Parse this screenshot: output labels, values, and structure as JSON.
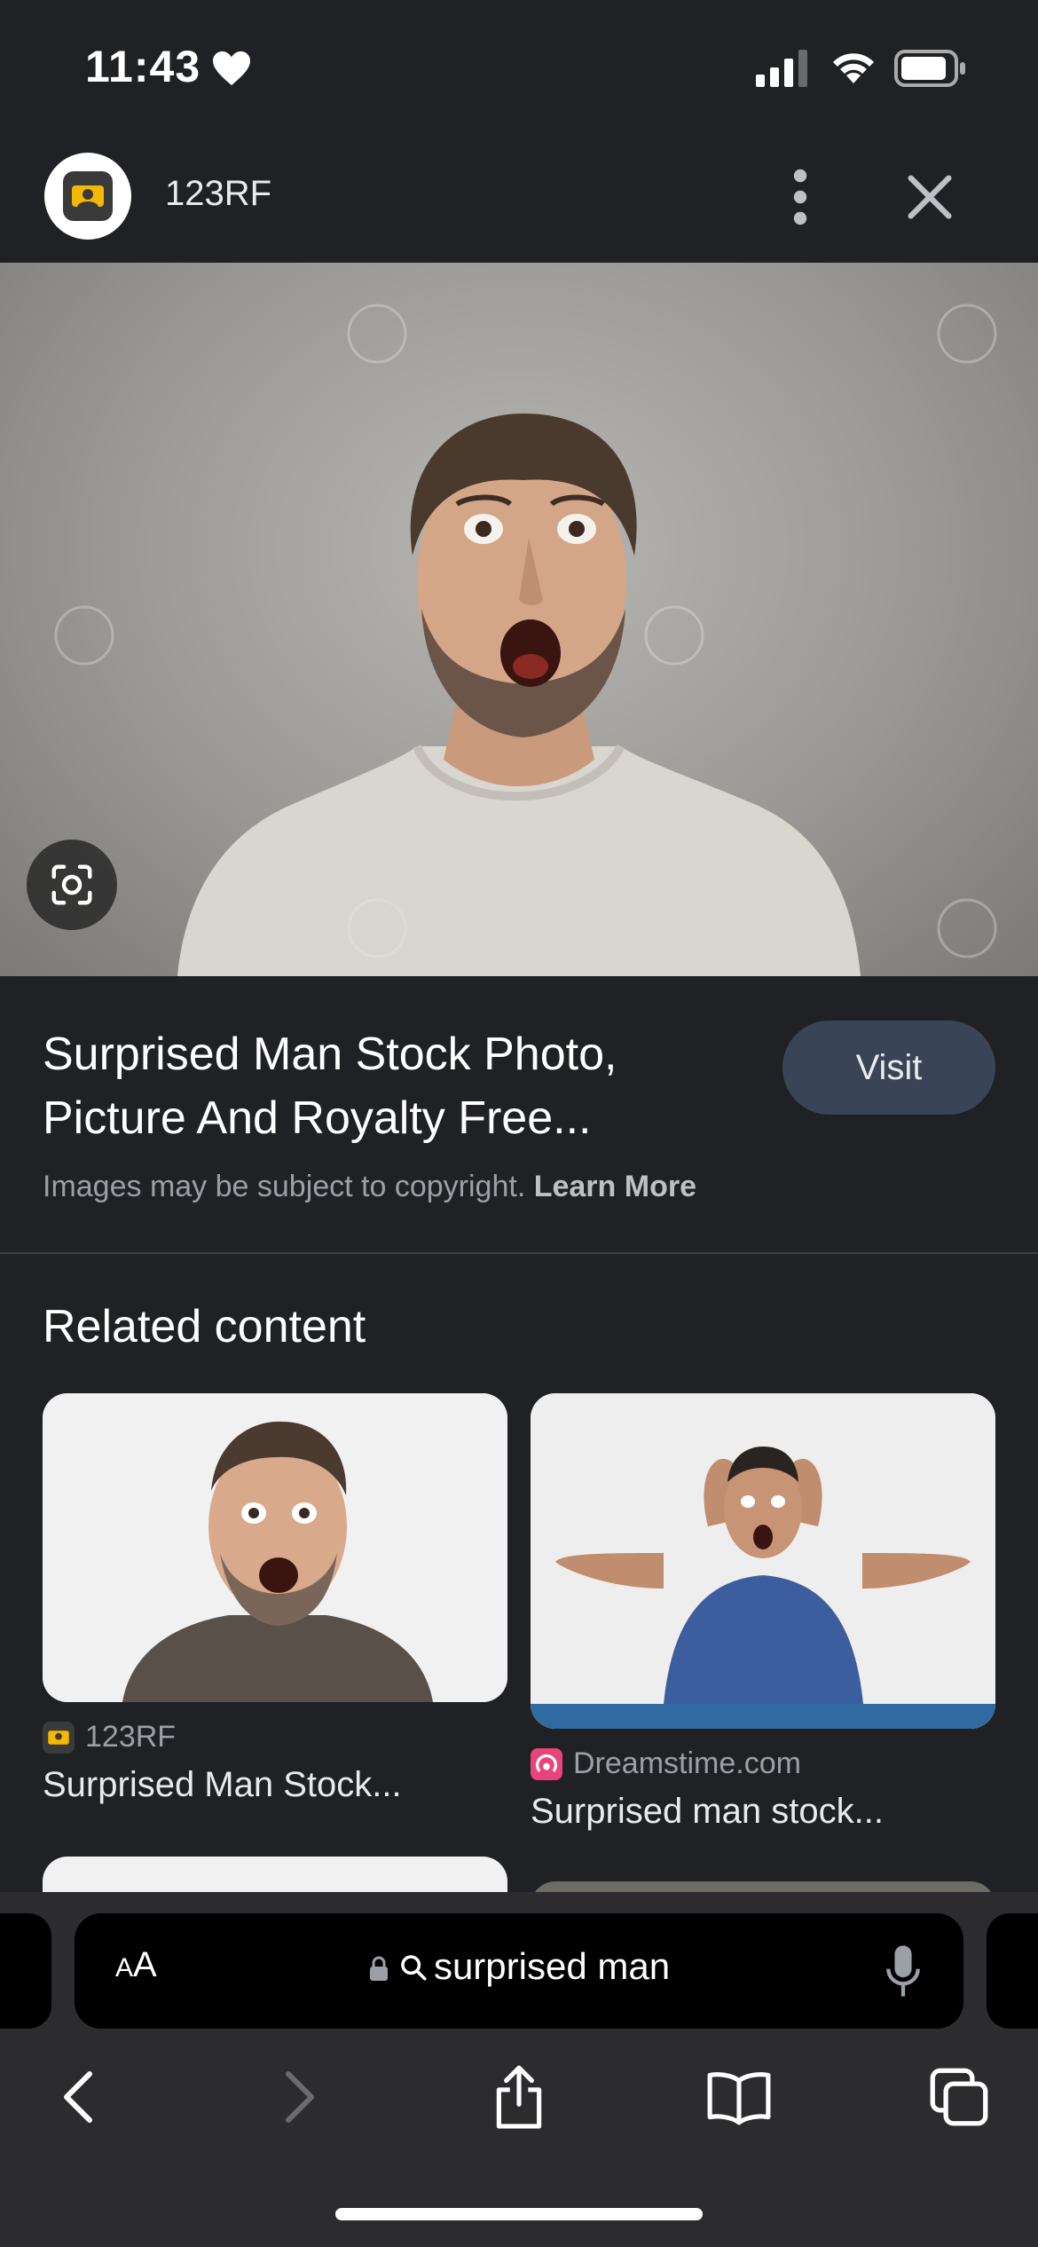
{
  "status_bar": {
    "time": "11:43"
  },
  "header": {
    "site_name": "123RF"
  },
  "result": {
    "title": "Surprised Man Stock Photo, Picture And Royalty Free...",
    "visit_label": "Visit",
    "copyright_text": "Images may be subject to copyright.",
    "learn_more": "Learn More"
  },
  "related": {
    "heading": "Related content",
    "cards": [
      {
        "source": "123RF",
        "caption": "Surprised Man Stock..."
      },
      {
        "source": "Dreamstime.com",
        "caption": "Surprised man stock..."
      }
    ]
  },
  "browser": {
    "text_size_label_small": "A",
    "text_size_label_large": "A",
    "address": "surprised man"
  },
  "colors": {
    "background": "#202124",
    "visit_button": "#394457",
    "toolbar": "#2c2c2e"
  },
  "icons": [
    "heart-icon",
    "signal-icon",
    "wifi-icon",
    "battery-icon",
    "more-vert-icon",
    "close-icon",
    "lens-icon",
    "lock-icon",
    "search-icon",
    "mic-icon",
    "back-icon",
    "forward-icon",
    "share-icon",
    "bookmarks-icon",
    "tabs-icon"
  ]
}
